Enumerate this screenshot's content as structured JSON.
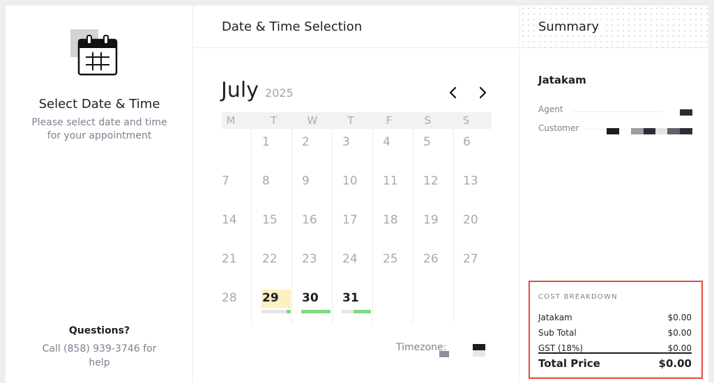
{
  "left_panel": {
    "title": "Select Date & Time",
    "description": "Please select date and time for your appointment",
    "questions_title": "Questions?",
    "questions_text": "Call (858) 939-3746 for help",
    "icon": "calendar-icon"
  },
  "middle_panel": {
    "header": "Date & Time Selection",
    "month": "July",
    "year": "2025",
    "weekdays": [
      "M",
      "T",
      "W",
      "T",
      "F",
      "S",
      "S"
    ],
    "weeks": [
      [
        "",
        "1",
        "2",
        "3",
        "4",
        "5",
        "6"
      ],
      [
        "7",
        "8",
        "9",
        "10",
        "11",
        "12",
        "13"
      ],
      [
        "14",
        "15",
        "16",
        "17",
        "18",
        "19",
        "20"
      ],
      [
        "21",
        "22",
        "23",
        "24",
        "25",
        "26",
        "27"
      ],
      [
        "28",
        "29",
        "30",
        "31",
        "",
        "",
        ""
      ]
    ],
    "available_days": [
      "29",
      "30",
      "31"
    ],
    "selected_day": "29",
    "availability": [
      {
        "day": "29",
        "fraction": 0.15
      },
      {
        "day": "30",
        "fraction": 1.0
      },
      {
        "day": "31",
        "fraction": 0.6
      }
    ],
    "timezone_label": "Timezone:"
  },
  "summary_panel": {
    "header": "Summary",
    "service_name": "Jatakam",
    "agent_label": "Agent",
    "customer_label": "Customer",
    "cost_breakdown": {
      "title": "COST BREAKDOWN",
      "rows": [
        {
          "label": "Jatakam",
          "value": "$0.00"
        },
        {
          "label": "Sub Total",
          "value": "$0.00"
        },
        {
          "label": "GST (18%)",
          "value": "$0.00"
        }
      ],
      "total_label": "Total Price",
      "total_value": "$0.00"
    }
  },
  "colors": {
    "highlight": "#fdf0c2",
    "available_bar": "#7fd882",
    "cost_border": "#e34a3c",
    "muted_text": "#7b8290"
  }
}
